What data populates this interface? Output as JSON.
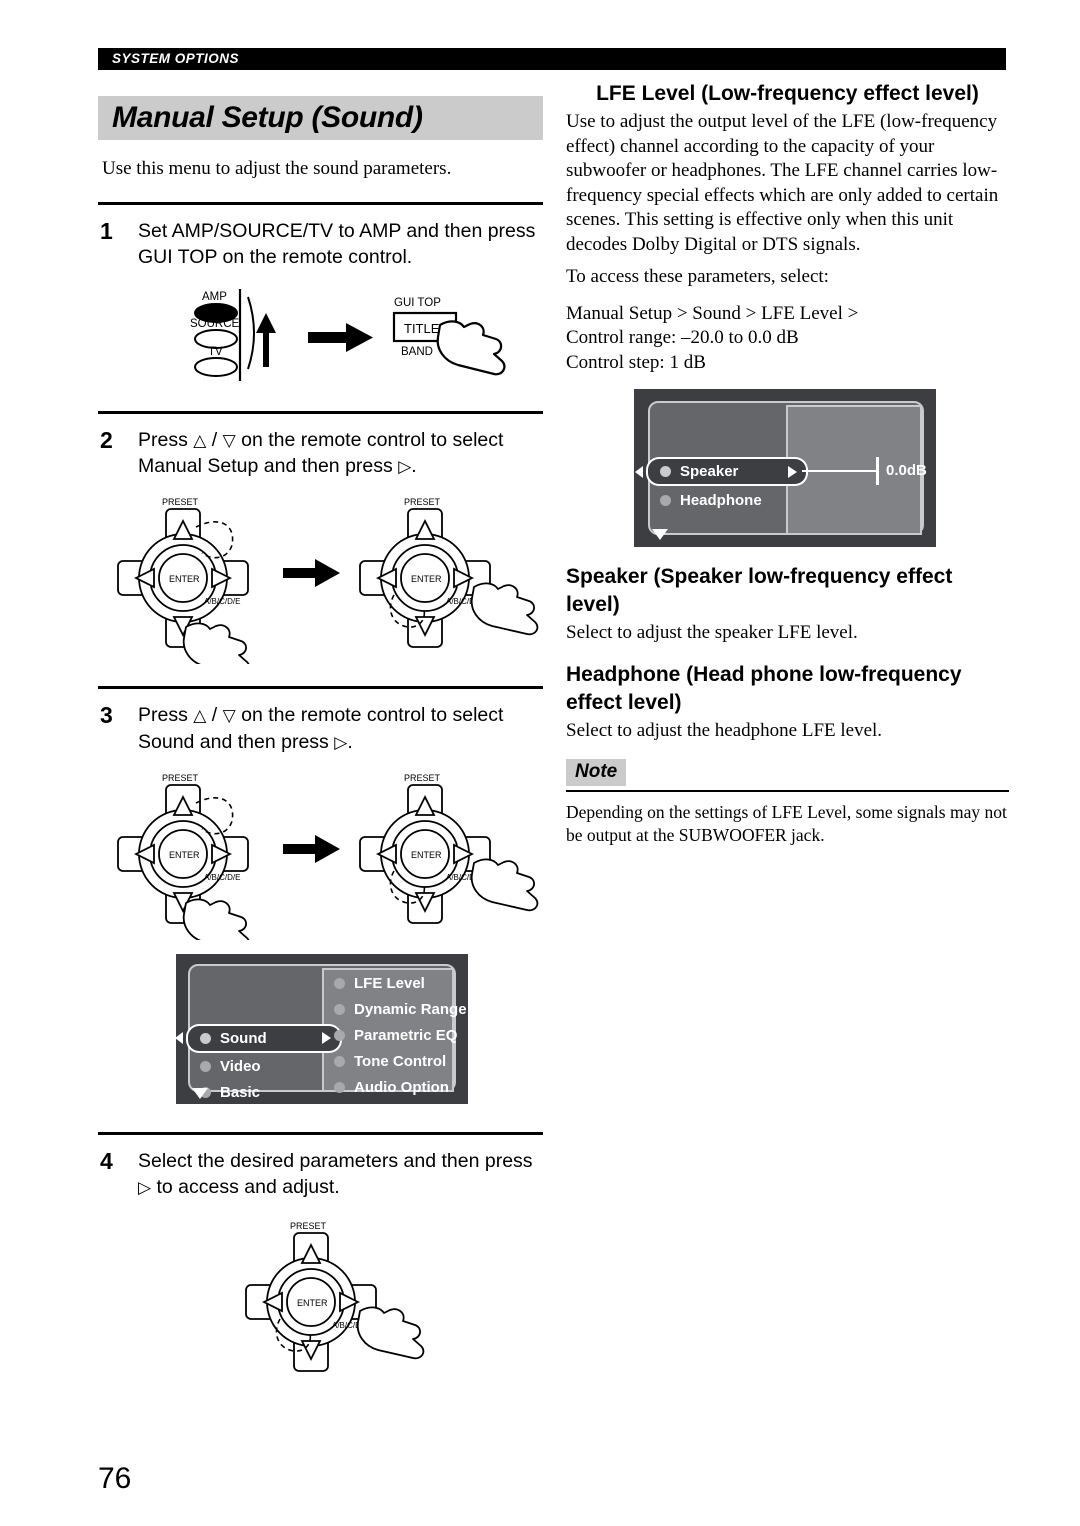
{
  "running_header": "SYSTEM OPTIONS",
  "page_number": "76",
  "left_column": {
    "section_title": "Manual Setup (Sound)",
    "intro": "Use this menu to adjust the sound parameters.",
    "steps": [
      {
        "number": "1",
        "text": "Set AMP/SOURCE/TV to AMP and then press GUI TOP on the remote control.",
        "figure": {
          "name": "amp-source-tv-switch-figure",
          "switch_labels": [
            "AMP",
            "SOURCE",
            "TV"
          ],
          "selected_switch": "AMP",
          "button_top_label": "GUI TOP",
          "button_label": "TITLE",
          "button_bottom_label": "BAND"
        }
      },
      {
        "number": "2",
        "text_before": "Press",
        "glyph_up": "△",
        "glyph_sep": "/",
        "glyph_down": "▽",
        "text_middle": "on the remote control to select Manual Setup and then press",
        "glyph_right": "▷",
        "text_after": ".",
        "figure": {
          "name": "remote-dpad-down-then-right-figure",
          "preset_label": "PRESET",
          "enter_label": "ENTER",
          "abcde_label": "A/B/C/D/E"
        }
      },
      {
        "number": "3",
        "text_before": "Press",
        "glyph_up": "△",
        "glyph_sep": "/",
        "glyph_down": "▽",
        "text_middle": "on the remote control to select Sound and then press",
        "glyph_right": "▷",
        "text_after": ".",
        "figure": {
          "name": "remote-dpad-down-then-right-figure",
          "preset_label": "PRESET",
          "enter_label": "ENTER",
          "abcde_label": "A/B/C/D/E"
        }
      },
      {
        "number": "4",
        "text_before": "Select the desired parameters and then press",
        "glyph_right": "▷",
        "text_after": "to access and adjust.",
        "figure": {
          "name": "remote-dpad-right-figure",
          "preset_label": "PRESET",
          "enter_label": "ENTER",
          "abcde_label": "A/B/C/D/E"
        }
      }
    ],
    "osd_sound_menu": {
      "left_items": [
        "Sound",
        "Video",
        "Basic"
      ],
      "selected_left_item": "Sound",
      "right_items": [
        "LFE Level",
        "Dynamic Range",
        "Parametric EQ",
        "Tone Control",
        "Audio Option"
      ]
    }
  },
  "right_column": {
    "lfe_heading": "LFE Level (Low-frequency effect level)",
    "lfe_body": "Use to adjust the output level of the LFE (low-frequency effect) channel according to the capacity of your subwoofer or headphones. The LFE channel carries low-frequency special effects which are only added to certain scenes. This setting is effective only when this unit decodes Dolby Digital or DTS signals.",
    "access_intro": "To access these parameters, select:",
    "access_path": "Manual Setup > Sound > LFE Level >",
    "control_range": "Control range: –20.0 to 0.0 dB",
    "control_step": "Control step: 1 dB",
    "osd_lfe_menu": {
      "left_items": [
        "Speaker",
        "Headphone"
      ],
      "selected_left_item": "Speaker",
      "value": "0.0dB"
    },
    "speaker_heading": "Speaker (Speaker low-frequency effect level)",
    "speaker_body": "Select to adjust the speaker LFE level.",
    "headphone_heading": "Headphone (Head phone low-frequency effect level)",
    "headphone_body": "Select to adjust the headphone LFE level.",
    "note_label": "Note",
    "note_body": "Depending on the settings of LFE Level, some signals may not be output at the SUBWOOFER jack."
  }
}
